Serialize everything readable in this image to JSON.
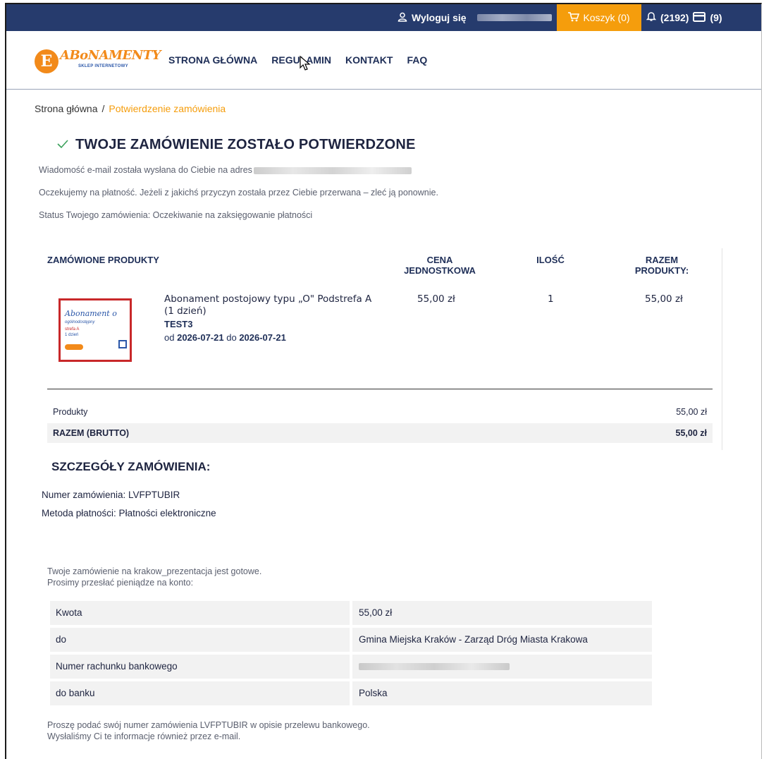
{
  "topbar": {
    "logout_label": "Wyloguj się",
    "cart_label": "Koszyk (0)",
    "notifications_label": "(2192)",
    "cards_label": "(9)"
  },
  "logo": {
    "letter": "E",
    "name": "ABoNAMENTY",
    "sub": "SKLEP INTERNETOWY"
  },
  "nav": {
    "items": [
      "STRONA GŁÓWNA",
      "REGULAMIN",
      "KONTAKT",
      "FAQ"
    ]
  },
  "breadcrumb": {
    "home": "Strona główna",
    "separator": "/",
    "current": "Potwierdzenie zamówienia"
  },
  "confirmation": {
    "title": "TWOJE ZAMÓWIENIE ZOSTAŁO POTWIERDZONE",
    "email_text": "Wiadomość e-mail została wysłana do Ciebie na adres",
    "payment_text": "Oczekujemy na płatność. Jeżeli z jakichś przyczyn została przez Ciebie przerwana – zleć ją ponownie.",
    "status_text": "Status Twojego zamówienia: Oczekiwanie na zaksięgowanie płatności"
  },
  "products": {
    "headers": {
      "products": "ZAMÓWIONE PRODUKTY",
      "unit_price_1": "CENA",
      "unit_price_2": "JEDNOSTKOWA",
      "qty": "ILOŚĆ",
      "total_1": "RAZEM",
      "total_2": "PRODUKTY:"
    },
    "thumb": {
      "line1": "Abonament o",
      "line2": "ogólnodostępny",
      "line3": "strefa A",
      "line4": "1 dzień"
    },
    "item": {
      "name": "Abonament postojowy typu „O\" Podstrefa A (1 dzień)",
      "code": "TEST3",
      "date_from_label": "od",
      "date_from": "2026-07-21",
      "date_to_label": "do",
      "date_to": "2026-07-21",
      "unit_price": "55,00 zł",
      "qty": "1",
      "total": "55,00 zł"
    }
  },
  "summary": {
    "products_label": "Produkty",
    "products_value": "55,00 zł",
    "total_label": "RAZEM (BRUTTO)",
    "total_value": "55,00 zł"
  },
  "details": {
    "title": "SZCZEGÓŁY ZAMÓWIENIA:",
    "order_number": "Numer zamówienia: LVFPTUBIR",
    "payment_method": "Metoda płatności: Płatności elektroniczne"
  },
  "transfer": {
    "ready_text": "Twoje zamówienie na krakow_prezentacja jest gotowe.",
    "please_text": "Prosimy przesłać pieniądze na konto:",
    "rows": [
      {
        "key": "Kwota",
        "value": "55,00 zł"
      },
      {
        "key": "do",
        "value": "Gmina Miejska Kraków - Zarząd Dróg Miasta Krakowa"
      },
      {
        "key": "Numer rachunku bankowego",
        "value": ""
      },
      {
        "key": "do banku",
        "value": "Polska"
      }
    ],
    "footer_1": "Proszę podać swój numer zamówienia LVFPTUBIR w opisie przelewu bankowego.",
    "footer_2": "Wysłaliśmy Ci te informacje również przez e-mail."
  },
  "colors": {
    "topbar": "#263b6d",
    "accent": "#f59d0c",
    "success": "#3aa05a",
    "thumb_border": "#c8282a"
  }
}
